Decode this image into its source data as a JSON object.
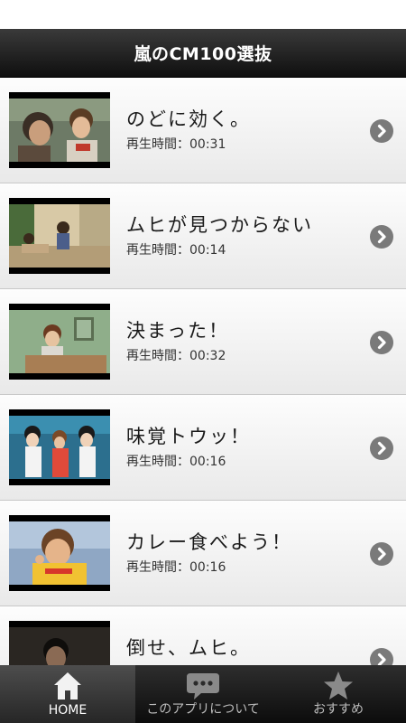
{
  "header": {
    "title": "嵐のCM100選抜"
  },
  "duration_label": "再生時間：",
  "videos": [
    {
      "title": "のどに効く。",
      "duration": "00:31"
    },
    {
      "title": "ムヒが見つからない",
      "duration": "00:14"
    },
    {
      "title": "決まった！",
      "duration": "00:32"
    },
    {
      "title": "味覚トウッ！",
      "duration": "00:16"
    },
    {
      "title": "カレー食べよう！",
      "duration": "00:16"
    },
    {
      "title": "倒せ、ムヒ。",
      "duration": ""
    }
  ],
  "tabs": [
    {
      "label": "HOME",
      "icon": "home-icon",
      "active": true
    },
    {
      "label": "このアプリについて",
      "icon": "speech-bubble-icon",
      "active": false
    },
    {
      "label": "おすすめ",
      "icon": "star-icon",
      "active": false
    }
  ],
  "colors": {
    "header_bg": "#1a1a1a",
    "chevron": "#7a7a7a",
    "tab_active": "#3a3a3a"
  }
}
